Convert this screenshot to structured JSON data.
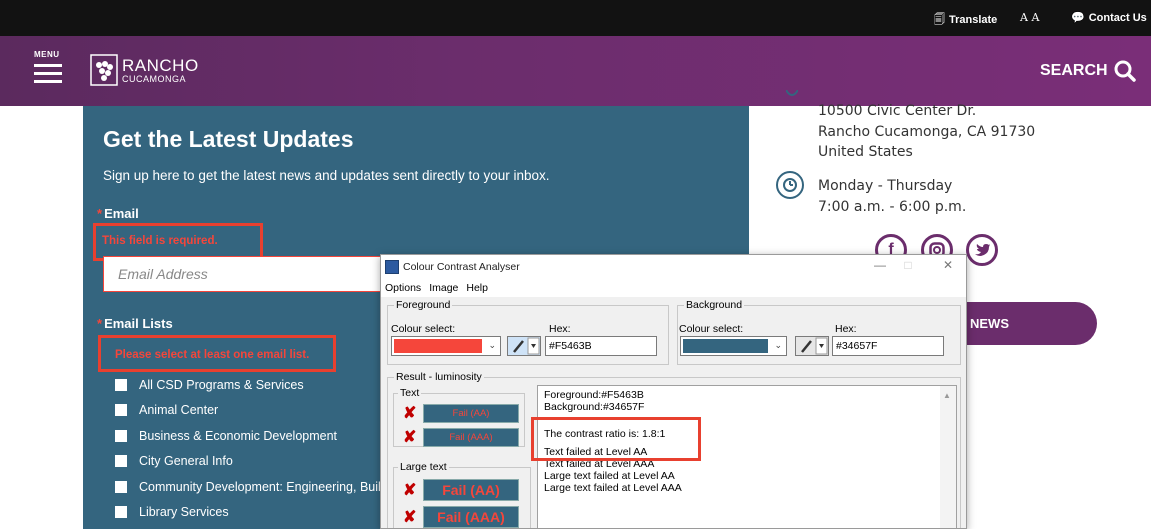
{
  "utility_bar": {
    "translate_label": "Translate",
    "text_size_label": "A A",
    "contact_label": "Contact Us"
  },
  "header": {
    "menu_label": "MENU",
    "logo_line1": "RANCHO",
    "logo_line2": "CUCAMONGA",
    "search_label": "SEARCH"
  },
  "signup": {
    "title": "Get the Latest Updates",
    "intro": "Sign up here to get the latest news and updates sent directly to your inbox.",
    "email_label": "Email",
    "email_error": "This field is required.",
    "email_placeholder": "Email Address",
    "lists_label": "Email Lists",
    "lists_error": "Please select at least one email list.",
    "lists": [
      "All CSD Programs & Services",
      "Animal Center",
      "Business & Economic Development",
      "City General Info",
      "Community Development: Engineering, Building",
      "Library Services"
    ]
  },
  "contact": {
    "address_line1": "10500 Civic Center Dr.",
    "address_line2": "Rancho Cucamonga, CA 91730",
    "address_line3": "United States",
    "hours_line1": "Monday - Thursday",
    "hours_line2": "7:00 a.m. - 6:00 p.m.",
    "news_button": "NEWS"
  },
  "cca": {
    "title": "Colour Contrast Analyser",
    "menu": [
      "Options",
      "Image",
      "Help"
    ],
    "foreground": {
      "group": "Foreground",
      "colour_select_label": "Colour select:",
      "hex_label": "Hex:",
      "hex": "#F5463B",
      "color": "#f5463b"
    },
    "background": {
      "group": "Background",
      "colour_select_label": "Colour select:",
      "hex_label": "Hex:",
      "hex": "#34657F",
      "color": "#34657f"
    },
    "result_group": "Result - luminosity",
    "text_label": "Text",
    "large_text_label": "Large text",
    "fail_aa": "Fail (AA)",
    "fail_aaa": "Fail (AAA)",
    "results": {
      "fg_line": "Foreground:#F5463B",
      "bg_line": "Background:#34657F",
      "ratio_line": "The contrast ratio is: 1.8:1",
      "l1": "Text failed at Level AA",
      "l2": "Text failed at Level AAA",
      "l3": "Large text failed at Level AA",
      "l4": "Large text failed at Level AAA"
    }
  },
  "colors": {
    "brand_purple": "#6b2d6c",
    "panel_blue": "#34657f",
    "error_red": "#f5463b",
    "callout_red": "#e8402f"
  }
}
